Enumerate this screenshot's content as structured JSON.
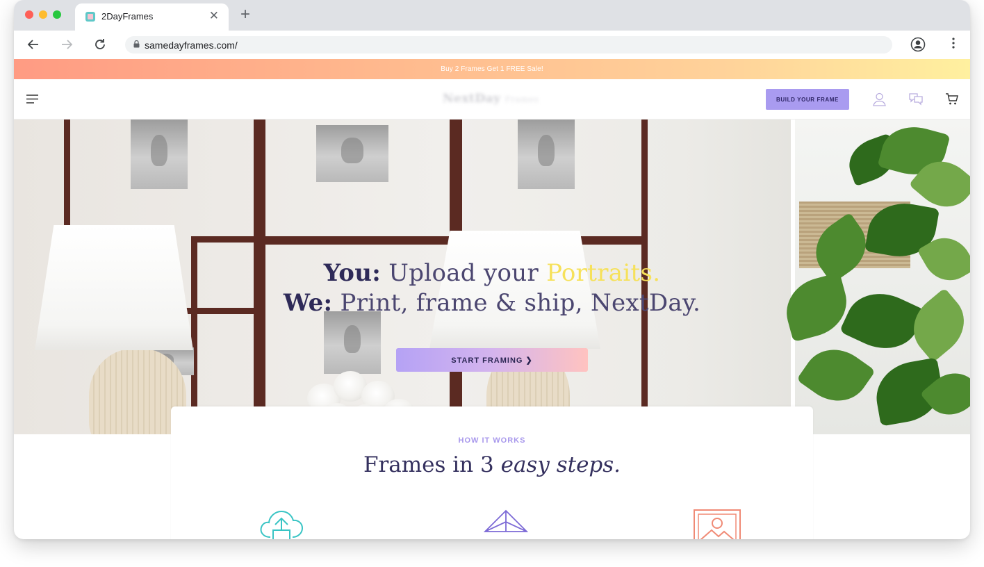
{
  "browser": {
    "tab_title": "2DayFrames",
    "url": "samedayframes.com/"
  },
  "promo": {
    "text": "Buy 2 Frames Get 1 FREE Sale!"
  },
  "header": {
    "logo_main": "NextDay",
    "logo_sub": "Frames",
    "build_button": "BUILD YOUR FRAME",
    "icons": [
      "menu-icon",
      "user-icon",
      "chat-icon",
      "cart-icon"
    ]
  },
  "hero": {
    "line1_bold": "You:",
    "line1_text": "Upload your",
    "line1_highlight": "Portraits.",
    "line2_bold": "We:",
    "line2_text": "Print, frame & ship, NextDay.",
    "cta": "START FRAMING ❯"
  },
  "how": {
    "label": "HOW IT WORKS",
    "title_plain": "Frames in 3",
    "title_italic": "easy steps.",
    "step_icons": [
      "cloud-upload-icon",
      "paper-plane-icon",
      "framed-photo-icon"
    ]
  },
  "colors": {
    "accent_purple": "#a99bf0",
    "headline_navy": "#2e2a58",
    "highlight_yellow": "#f6e15a",
    "teal": "#38c4c4",
    "coral": "#f08a75"
  }
}
